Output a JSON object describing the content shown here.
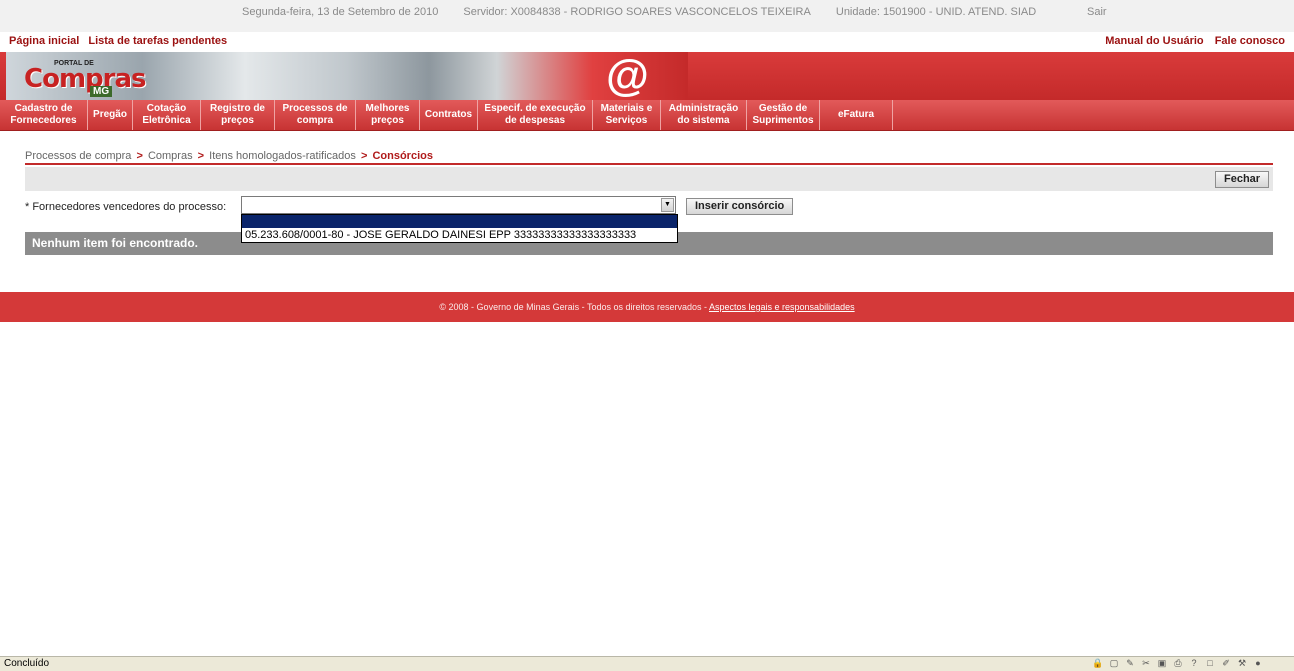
{
  "header": {
    "date": "Segunda-feira, 13 de Setembro de 2010",
    "server": "Servidor: X0084838 - RODRIGO SOARES VASCONCELOS TEIXEIRA",
    "unit": "Unidade: 1501900 - UNID. ATEND. SIAD",
    "logout": "Sair"
  },
  "toplinks": {
    "home": "Página inicial",
    "tasks": "Lista de tarefas pendentes",
    "manual": "Manual do Usuário",
    "contact": "Fale conosco"
  },
  "logo": {
    "portal": "PORTAL DE",
    "name": "Compras",
    "region": "MG",
    "at": "@"
  },
  "menu": [
    {
      "line1": "Cadastro de",
      "line2": "Fornecedores"
    },
    {
      "line1": "Pregão",
      "line2": ""
    },
    {
      "line1": "Cotação",
      "line2": "Eletrônica"
    },
    {
      "line1": "Registro de",
      "line2": "preços"
    },
    {
      "line1": "Processos de",
      "line2": "compra"
    },
    {
      "line1": "Melhores",
      "line2": "preços"
    },
    {
      "line1": "Contratos",
      "line2": ""
    },
    {
      "line1": "Especif. de execução",
      "line2": "de despesas"
    },
    {
      "line1": "Materiais e",
      "line2": "Serviços"
    },
    {
      "line1": "Administração",
      "line2": "do sistema"
    },
    {
      "line1": "Gestão de",
      "line2": "Suprimentos"
    },
    {
      "line1": "eFatura",
      "line2": ""
    }
  ],
  "breadcrumb": {
    "b1": "Processos de compra",
    "b2": "Compras",
    "b3": "Itens homologados-ratificados",
    "current": "Consórcios",
    "separator": ">"
  },
  "toolbar": {
    "close_label": "Fechar"
  },
  "form": {
    "label": "* Fornecedores vencedores do processo:",
    "selected_value": "",
    "insert_label": "Inserir consórcio",
    "options": [
      "",
      "05.233.608/0001-80 - JOSE GERALDO DAINESI EPP 33333333333333333333"
    ]
  },
  "results": {
    "empty_message": "Nenhum item foi encontrado."
  },
  "footer": {
    "text": "© 2008 - Governo de Minas Gerais - Todos os direitos reservados - ",
    "link": "Aspectos legais e responsabilidades"
  },
  "statusbar": {
    "text": "Concluído"
  },
  "colors": {
    "brand_red": "#c72222",
    "menu_red": "#d43939",
    "selection_blue": "#0a246a"
  }
}
